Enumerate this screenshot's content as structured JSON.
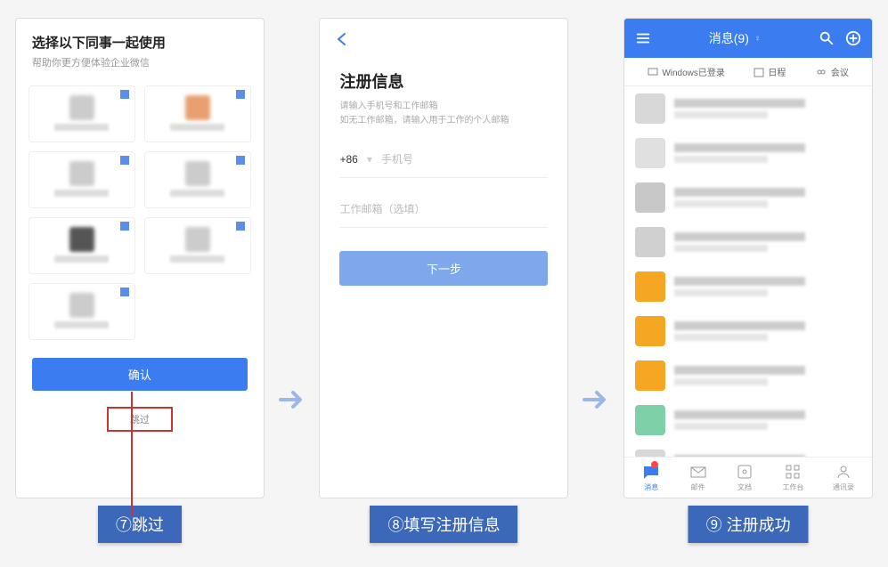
{
  "screen1": {
    "title": "选择以下同事一起使用",
    "subtitle": "帮助你更方便体验企业微信",
    "confirm_label": "确认",
    "skip_label": "跳过"
  },
  "screen2": {
    "title": "注册信息",
    "hint_line1": "请输入手机号和工作邮箱",
    "hint_line2": "如无工作邮箱，请输入用于工作的个人邮箱",
    "phone_prefix": "+86",
    "phone_placeholder": "手机号",
    "email_placeholder": "工作邮箱（选填）",
    "next_label": "下一步"
  },
  "screen3": {
    "header_title": "消息(9)",
    "tab_windows": "Windows已登录",
    "tab_schedule": "日程",
    "tab_meeting": "会议",
    "nav_messages": "消息",
    "nav_mail": "邮件",
    "nav_doc": "文档",
    "nav_workspace": "工作台",
    "nav_contacts": "通讯录",
    "avatar_colors": [
      "#d8d8d8",
      "#e0e0e0",
      "#c8c8c8",
      "#d0d0d0",
      "#f5a623",
      "#f5a623",
      "#f5a623",
      "#7ed0a8",
      "#d8d8d8",
      "#3b7df0"
    ]
  },
  "steps": {
    "step7": "⑦跳过",
    "step8": "⑧填写注册信息",
    "step9": "⑨ 注册成功"
  }
}
